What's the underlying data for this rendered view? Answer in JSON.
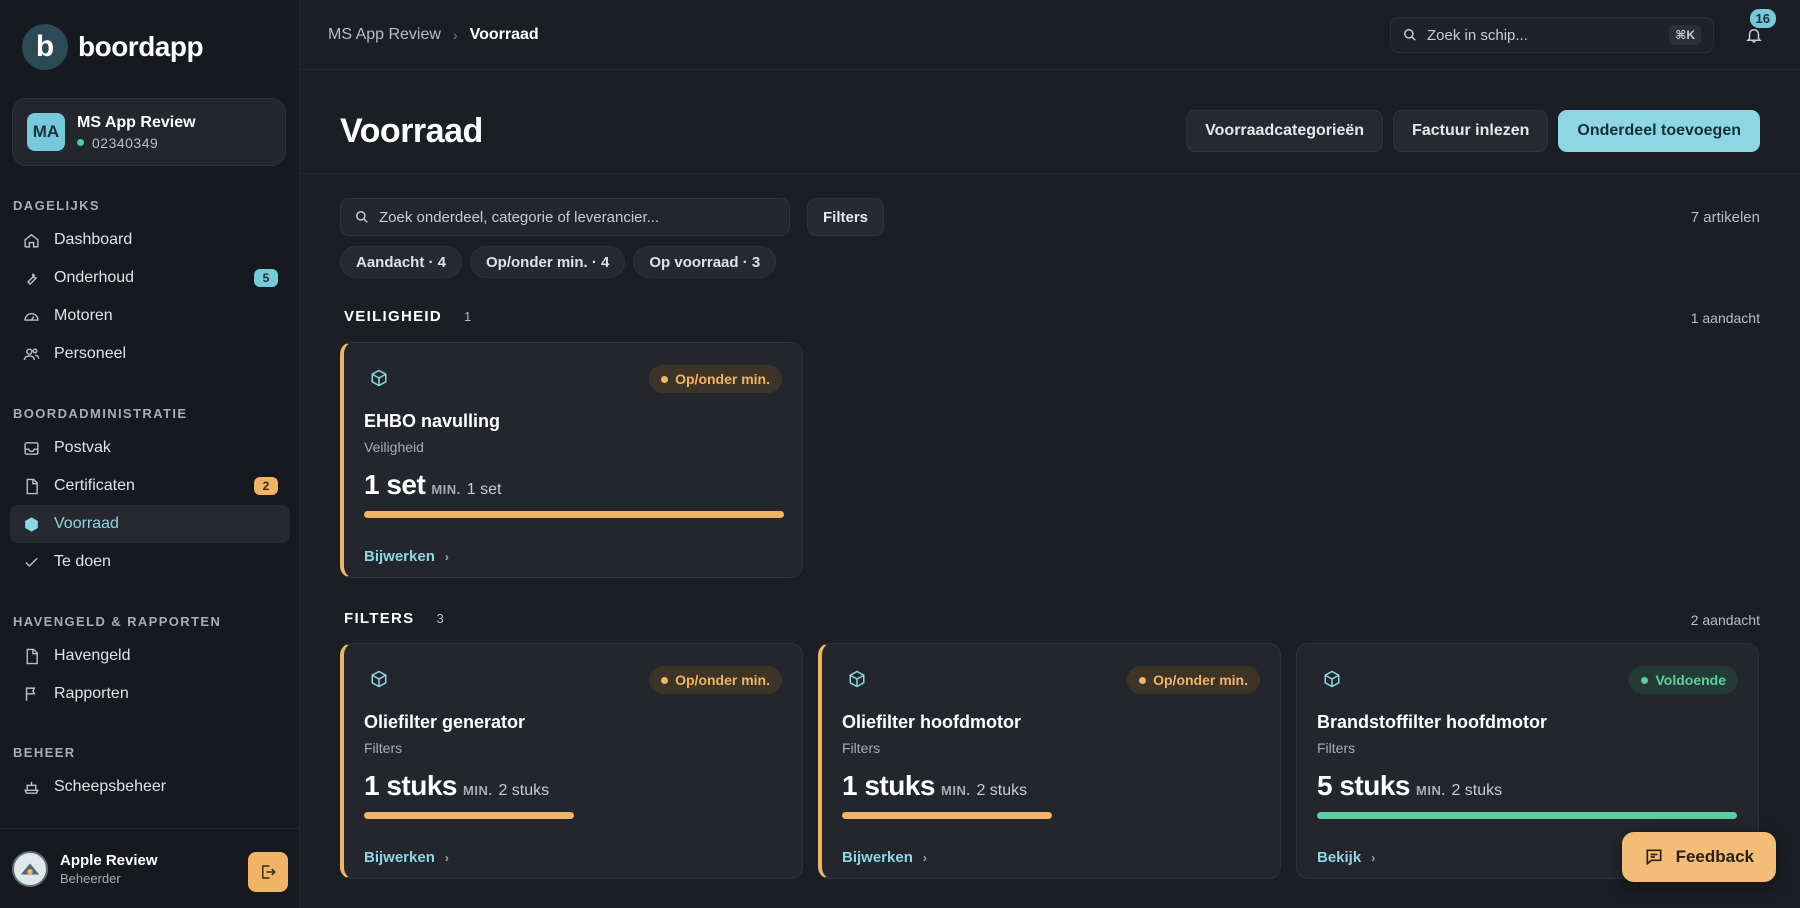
{
  "brand": {
    "name": "boordapp",
    "mark": "b"
  },
  "ship": {
    "initials": "MA",
    "name": "MS App Review",
    "id": "02340349"
  },
  "nav": {
    "sections": [
      {
        "heading": "DAGELIJKS",
        "items": [
          {
            "label": "Dashboard",
            "icon": "home-icon",
            "badge": ""
          },
          {
            "label": "Onderhoud",
            "icon": "wrench-icon",
            "badge": "5"
          },
          {
            "label": "Motoren",
            "icon": "gauge-icon",
            "badge": ""
          },
          {
            "label": "Personeel",
            "icon": "users-icon",
            "badge": ""
          }
        ]
      },
      {
        "heading": "BOORDADMINISTRATIE",
        "items": [
          {
            "label": "Postvak",
            "icon": "inbox-icon",
            "badge": ""
          },
          {
            "label": "Certificaten",
            "icon": "file-icon",
            "badge": "2"
          },
          {
            "label": "Voorraad",
            "icon": "box-icon",
            "badge": "",
            "active": true
          },
          {
            "label": "Te doen",
            "icon": "check-icon",
            "badge": ""
          }
        ]
      },
      {
        "heading": "HAVENGELD & RAPPORTEN",
        "items": [
          {
            "label": "Havengeld",
            "icon": "file-icon",
            "badge": ""
          },
          {
            "label": "Rapporten",
            "icon": "flag-icon",
            "badge": ""
          }
        ]
      },
      {
        "heading": "BEHEER",
        "items": [
          {
            "label": "Scheepsbeheer",
            "icon": "ship-icon",
            "badge": ""
          }
        ]
      }
    ]
  },
  "user": {
    "name": "Apple Review",
    "role": "Beheerder"
  },
  "topbar": {
    "breadcrumb": [
      "MS App Review",
      "Voorraad"
    ],
    "search_placeholder": "Zoek in schip...",
    "search_shortcut": "⌘K",
    "notification_count": "16"
  },
  "page": {
    "title": "Voorraad",
    "actions": {
      "categories": "Voorraadcategorieën",
      "invoice": "Factuur inlezen",
      "add": "Onderdeel toevoegen"
    },
    "search_placeholder": "Zoek onderdeel, categorie of leverancier...",
    "filters_label": "Filters",
    "count_text": "7 artikelen",
    "chips": [
      "Aandacht · 4",
      "Op/onder min. · 4",
      "Op voorraad · 3"
    ]
  },
  "colors": {
    "accent": "#8ed6e3",
    "warning": "#f0b467",
    "ok": "#5bd0a0"
  },
  "sections": [
    {
      "title": "VEILIGHEID",
      "count": "1",
      "attention": "1 aandacht",
      "cards": [
        {
          "title": "EHBO navulling",
          "category": "Veiligheid",
          "qty": "1 set",
          "min_label": "MIN.",
          "min_value": "1 set",
          "status": "Op/onder min.",
          "status_type": "warn",
          "fill": 1.0,
          "link": "Bijwerken"
        }
      ]
    },
    {
      "title": "FILTERS",
      "count": "3",
      "attention": "2 aandacht",
      "cards": [
        {
          "title": "Oliefilter generator",
          "category": "Filters",
          "qty": "1 stuks",
          "min_label": "MIN.",
          "min_value": "2 stuks",
          "status": "Op/onder min.",
          "status_type": "warn",
          "fill": 0.5,
          "link": "Bijwerken"
        },
        {
          "title": "Oliefilter hoofdmotor",
          "category": "Filters",
          "qty": "1 stuks",
          "min_label": "MIN.",
          "min_value": "2 stuks",
          "status": "Op/onder min.",
          "status_type": "warn",
          "fill": 0.5,
          "link": "Bijwerken"
        },
        {
          "title": "Brandstoffilter hoofdmotor",
          "category": "Filters",
          "qty": "5 stuks",
          "min_label": "MIN.",
          "min_value": "2 stuks",
          "status": "Voldoende",
          "status_type": "ok",
          "fill": 1.0,
          "link": "Bekijk"
        }
      ]
    }
  ],
  "feedback_label": "Feedback"
}
